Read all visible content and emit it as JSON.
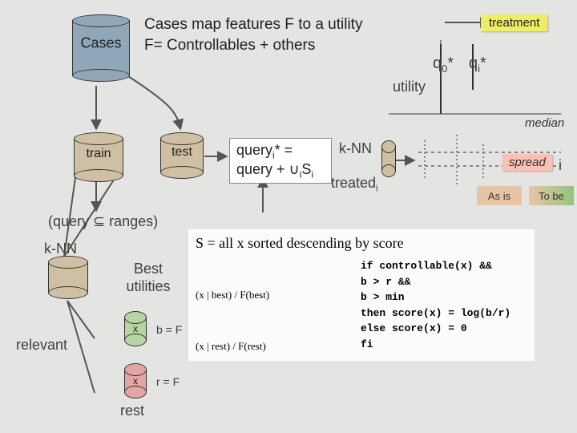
{
  "header": {
    "line1": "Cases map features F to a utility",
    "line2": "F= Controllables + others"
  },
  "treatment_label": "treatment",
  "cyl": {
    "cases": "Cases",
    "train": "train",
    "test": "test",
    "knn": "k-NN",
    "relevant": "relevant",
    "rest": "rest",
    "xsmall": "x"
  },
  "query_box": {
    "line1a": "query",
    "line1b": "* = ",
    "line2a": "query + ",
    "line2b": "S",
    "sub_i": "i"
  },
  "labels": {
    "knn": "k-NN",
    "treated": "treated",
    "utility": "utility",
    "q0": "q",
    "zero": "0",
    "star": "*",
    "qi": "q",
    "i": "i",
    "median": "median",
    "spread": "spread",
    "i_letter": "i",
    "asis": "As is",
    "tobe": "To be",
    "query_in_ranges_a": "(query ",
    "query_in_ranges_b": " ranges)",
    "best_utilities_a": "Best",
    "best_utilities_b": "utilities",
    "b_eq": "b = F",
    "r_eq": "r = F"
  },
  "formula": {
    "top": "S = all x sorted descending by  score",
    "left": {
      "l1a": "(x | best) / F(best)",
      "l2a": "(x | rest) / F(rest)"
    },
    "right": {
      "r1": "if  controllable(x) &&",
      "r2": "    b > r  &&",
      "r3": "    b > min",
      "r4": "then score(x) = log(b/r)",
      "r5": "else score(x) = 0",
      "r6": "fi"
    }
  }
}
